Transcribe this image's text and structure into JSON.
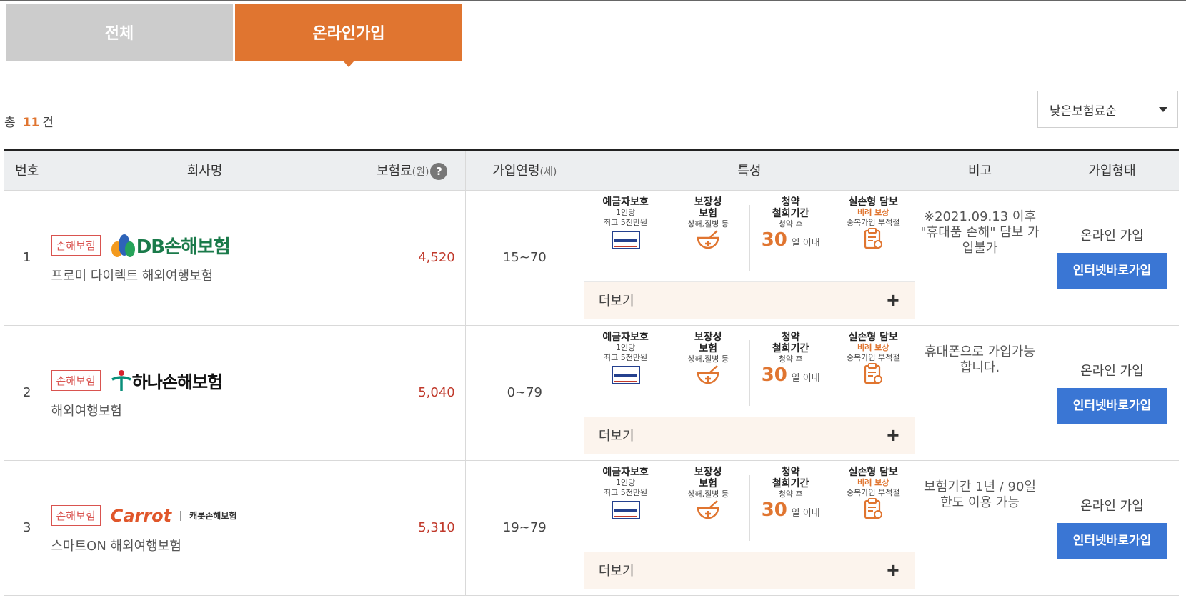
{
  "tabs": [
    {
      "label": "전체",
      "active": false
    },
    {
      "label": "온라인가입",
      "active": true
    }
  ],
  "total": {
    "prefix": "총",
    "count": "11",
    "suffix": "건"
  },
  "sort": {
    "selected": "낮은보험료순"
  },
  "table": {
    "headers": {
      "no": "번호",
      "company": "회사명",
      "premium": "보험료",
      "premium_unit": "(원)",
      "age": "가입연령",
      "age_unit": "(세)",
      "features": "특성",
      "note": "비고",
      "join": "가입형태"
    },
    "features": [
      {
        "title": "예금자보호",
        "line1": "1인당",
        "line2": "최고 5천만원",
        "icon": "kdic-protection-icon"
      },
      {
        "title": "보장성",
        "title2": "보험",
        "line1": "상해,질병 등",
        "icon": "medicine-bowl-icon"
      },
      {
        "title": "청약",
        "title2": "철회기간",
        "line1": "청약 후",
        "big": "30",
        "big_suffix": "일 이내"
      },
      {
        "title": "실손형 담보",
        "line1": "비례 보상",
        "line2": "중복가입 부적절",
        "icon": "clipboard-check-icon"
      }
    ],
    "more_label": "더보기",
    "rows": [
      {
        "no": "1",
        "badge": "손해보험",
        "logo": "DB손해보험",
        "product": "프로미 다이렉트 해외여행보험",
        "premium": "4,520",
        "age": "15~70",
        "note": "※2021.09.13 이후 \"휴대품 손해\" 담보 가입불가",
        "join_type": "온라인 가입",
        "join_button": "인터넷바로가입"
      },
      {
        "no": "2",
        "badge": "손해보험",
        "logo": "하나손해보험",
        "product": "해외여행보험",
        "premium": "5,040",
        "age": "0~79",
        "note": "휴대폰으로 가입가능합니다.",
        "join_type": "온라인 가입",
        "join_button": "인터넷바로가입"
      },
      {
        "no": "3",
        "badge": "손해보험",
        "logo": "Carrot",
        "logo_sub": "캐롯손해보험",
        "product": "스마트ON 해외여행보험",
        "premium": "5,310",
        "age": "19~79",
        "note": "보험기간 1년 / 90일 한도 이용 가능",
        "join_type": "온라인 가입",
        "join_button": "인터넷바로가입"
      }
    ]
  },
  "colors": {
    "accent": "#e07530",
    "button": "#3a76d4",
    "badge": "#d9534f",
    "premium": "#c0392b"
  }
}
